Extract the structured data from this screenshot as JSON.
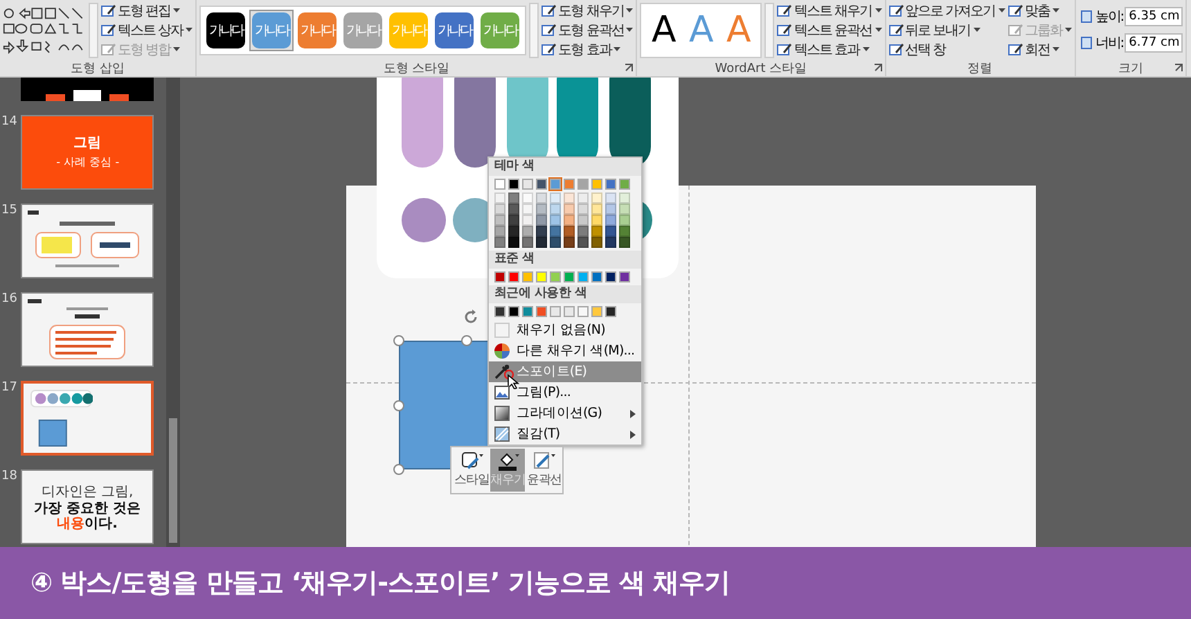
{
  "ribbon": {
    "groups": [
      {
        "kind": "shapes",
        "label": "도형 삽입",
        "launcher": false,
        "commands": [
          {
            "label": "도형 편집",
            "dropdown": true,
            "disabled": false
          },
          {
            "label": "텍스트 상자",
            "dropdown": true,
            "disabled": false
          },
          {
            "label": "도형 병합",
            "dropdown": true,
            "disabled": true
          }
        ]
      },
      {
        "kind": "shape_styles",
        "label": "도형 스타일",
        "launcher": true,
        "gallery": [
          {
            "text": "가나다",
            "color": "#000000",
            "selected": false
          },
          {
            "text": "가나다",
            "color": "#5b9bd5",
            "selected": true
          },
          {
            "text": "가나다",
            "color": "#ed7d31",
            "selected": false
          },
          {
            "text": "가나다",
            "color": "#a5a5a5",
            "selected": false
          },
          {
            "text": "가나다",
            "color": "#ffc000",
            "selected": false
          },
          {
            "text": "가나다",
            "color": "#4472c4",
            "selected": false
          },
          {
            "text": "가나다",
            "color": "#70ad47",
            "selected": false
          }
        ],
        "commands": [
          {
            "label": "도형 채우기",
            "dropdown": true,
            "disabled": false
          },
          {
            "label": "도형 윤곽선",
            "dropdown": true,
            "disabled": false
          },
          {
            "label": "도형 효과",
            "dropdown": true,
            "disabled": false
          }
        ]
      },
      {
        "kind": "wordart",
        "label": "WordArt 스타일",
        "launcher": true,
        "gallery": [
          {
            "text": "A",
            "color": "#000000"
          },
          {
            "text": "A",
            "color": "#5b9bd5"
          },
          {
            "text": "A",
            "color": "#ed7d31"
          }
        ],
        "commands": [
          {
            "label": "텍스트 채우기",
            "dropdown": true,
            "disabled": false
          },
          {
            "label": "텍스트 윤곽선",
            "dropdown": true,
            "disabled": false
          },
          {
            "label": "텍스트 효과",
            "dropdown": true,
            "disabled": false
          }
        ]
      },
      {
        "kind": "arrange",
        "label": "정렬",
        "launcher": false,
        "commands": [
          {
            "label": "앞으로 가져오기",
            "dropdown": true,
            "disabled": false
          },
          {
            "label": "뒤로 보내기",
            "dropdown": true,
            "disabled": false
          },
          {
            "label": "선택 창",
            "dropdown": false,
            "disabled": false
          },
          {
            "label": "맞춤",
            "dropdown": true,
            "disabled": false
          },
          {
            "label": "그룹화",
            "dropdown": true,
            "disabled": true
          },
          {
            "label": "회전",
            "dropdown": true,
            "disabled": false
          }
        ]
      },
      {
        "kind": "size",
        "label": "크기",
        "launcher": true,
        "fields": [
          {
            "label": "높이:",
            "value": "6.35 cm"
          },
          {
            "label": "너비:",
            "value": "6.77 cm"
          }
        ]
      }
    ]
  },
  "slides": [
    {
      "kind": "dark",
      "selected": false
    },
    {
      "number": "14",
      "kind": "title",
      "title": "그림",
      "subtitle": "- 사례 중심 -",
      "selected": false
    },
    {
      "number": "15",
      "kind": "diagram",
      "selected": false
    },
    {
      "number": "16",
      "kind": "list",
      "selected": false
    },
    {
      "number": "17",
      "kind": "shapes",
      "selected": true
    },
    {
      "number": "18",
      "kind": "quote",
      "lead": "디자인은 그림,",
      "headline": [
        {
          "text": "가장 중요한 것은 ",
          "highlight": false
        },
        {
          "text": "내용",
          "highlight": true
        },
        {
          "text": "이다.",
          "highlight": false
        }
      ],
      "selected": false
    }
  ],
  "color_menu": {
    "theme_header": "테마 색",
    "theme_colors": [
      {
        "color": "#ffffff",
        "selected": false
      },
      {
        "color": "#000000",
        "selected": false
      },
      {
        "color": "#e7e6e6",
        "selected": false
      },
      {
        "color": "#44546a",
        "selected": false
      },
      {
        "color": "#5b9bd5",
        "selected": true
      },
      {
        "color": "#ed7d31",
        "selected": false
      },
      {
        "color": "#a5a5a5",
        "selected": false
      },
      {
        "color": "#ffc000",
        "selected": false
      },
      {
        "color": "#4472c4",
        "selected": false
      },
      {
        "color": "#70ad47",
        "selected": false
      }
    ],
    "standard_header": "표준 색",
    "standard_colors": [
      {
        "color": "#c00000"
      },
      {
        "color": "#ff0000"
      },
      {
        "color": "#ffc000"
      },
      {
        "color": "#ffff00"
      },
      {
        "color": "#92d050"
      },
      {
        "color": "#00b050"
      },
      {
        "color": "#00b0f0"
      },
      {
        "color": "#0070c0"
      },
      {
        "color": "#002060"
      },
      {
        "color": "#7030a0"
      }
    ],
    "recent_header": "최근에 사용한 색",
    "recent_colors": [
      {
        "color": "#333333"
      },
      {
        "color": "#000000"
      },
      {
        "color": "#0f8c9c"
      },
      {
        "color": "#f04e23"
      },
      {
        "color": "#e8e8e8"
      },
      {
        "color": "#e8e8e8"
      },
      {
        "color": "#f7f7f7"
      },
      {
        "color": "#ffc83d"
      },
      {
        "color": "#262626"
      }
    ],
    "items": [
      {
        "kind": "no_fill",
        "label": "채우기 없음(N)",
        "selected": false,
        "submenu": false
      },
      {
        "kind": "more_colors",
        "label": "다른 채우기 색(M)...",
        "selected": false,
        "submenu": false
      },
      {
        "kind": "eyedropper",
        "label": "스포이트(E)",
        "selected": true,
        "submenu": false
      },
      {
        "kind": "picture",
        "label": "그림(P)...",
        "selected": false,
        "submenu": false
      },
      {
        "kind": "gradient",
        "label": "그라데이션(G)",
        "selected": false,
        "submenu": true
      },
      {
        "kind": "texture",
        "label": "질감(T)",
        "selected": false,
        "submenu": true
      }
    ]
  },
  "mini_toolbar": {
    "buttons": [
      {
        "kind": "style",
        "label": "스타일",
        "selected": false
      },
      {
        "kind": "fill",
        "label": "채우기",
        "selected": true
      },
      {
        "kind": "outline",
        "label": "윤곽선",
        "selected": false
      }
    ]
  },
  "caption": "④ 박스/도형을 만들고 ‘채우기-스포이트’ 기능으로 색 채우기"
}
